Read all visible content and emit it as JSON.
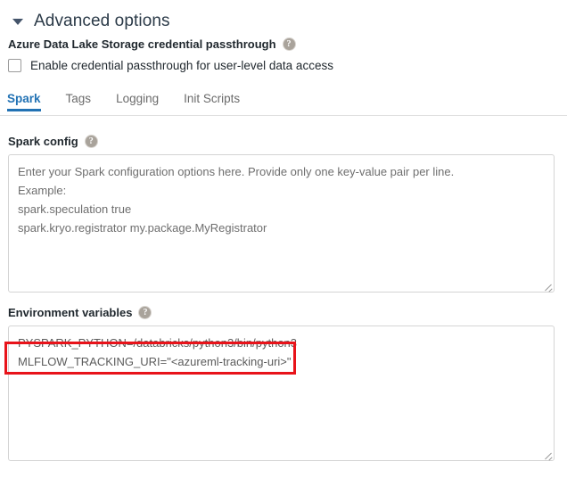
{
  "header": {
    "title": "Advanced options",
    "caret_icon": "triangle-down-icon"
  },
  "passthrough": {
    "label": "Azure Data Lake Storage credential passthrough",
    "help_icon": "help-circle-icon",
    "checkbox_label": "Enable credential passthrough for user-level data access",
    "checked": false
  },
  "tabs": [
    {
      "label": "Spark",
      "active": true
    },
    {
      "label": "Tags",
      "active": false
    },
    {
      "label": "Logging",
      "active": false
    },
    {
      "label": "Init Scripts",
      "active": false
    }
  ],
  "spark_config": {
    "label": "Spark config",
    "help_icon": "help-circle-icon",
    "placeholder_lines": [
      "Enter your Spark configuration options here. Provide only one key-value pair per line.",
      "Example:",
      "spark.speculation true",
      "spark.kryo.registrator my.package.MyRegistrator"
    ],
    "resize_handle": "resize-grip-icon"
  },
  "environment_variables": {
    "label": "Environment variables",
    "help_icon": "help-circle-icon",
    "value_lines": [
      "PYSPARK_PYTHON=/databricks/python3/bin/python3",
      "MLFLOW_TRACKING_URI=\"<azureml-tracking-uri>\""
    ],
    "resize_handle": "resize-grip-icon"
  },
  "annotation": {
    "color": "#e8131a",
    "type": "highlight-rectangle"
  },
  "colors": {
    "accent": "#2272b4",
    "text": "#1f272d",
    "muted": "#6e6e6e",
    "border": "#d4d4d4",
    "annotation": "#e8131a"
  }
}
